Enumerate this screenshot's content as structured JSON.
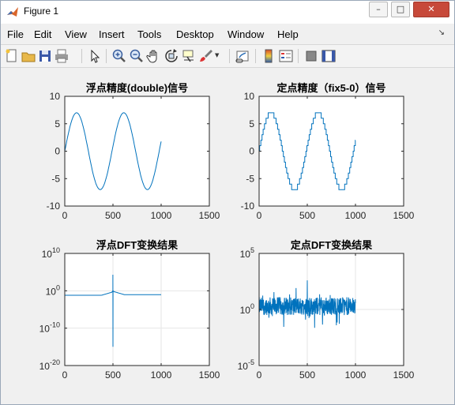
{
  "window": {
    "title": "Figure 1",
    "btn_minimize": "–",
    "btn_maximize": "□",
    "btn_close": "✕"
  },
  "menu": [
    "File",
    "Edit",
    "View",
    "Insert",
    "Tools",
    "Desktop",
    "Window",
    "Help"
  ],
  "toolbar_icons": [
    "new-figure-icon",
    "open-file-icon",
    "save-icon",
    "print-icon",
    "edit-plot-arrow-icon",
    "zoom-in-icon",
    "zoom-out-icon",
    "pan-hand-icon",
    "rotate-3d-icon",
    "data-cursor-icon",
    "brush-icon",
    "link-plot-icon",
    "colorbar-icon",
    "legend-icon",
    "hide-plot-tools-icon",
    "show-plot-tools-icon"
  ],
  "colors": {
    "line": "#0072bd",
    "grid": "#e6e6e6",
    "axes_bg": "#ffffff"
  },
  "chart_data": [
    {
      "type": "line",
      "title": "浮点精度(double)信号",
      "xlim": [
        0,
        1500
      ],
      "ylim": [
        -10,
        10
      ],
      "xticks": [
        "0",
        "500",
        "1000",
        "1500"
      ],
      "yticks": [
        "10",
        "5",
        "0",
        "-5",
        "-10"
      ],
      "series": [
        {
          "x_range": [
            0,
            1000
          ],
          "waveform": "sine",
          "amplitude": 7,
          "period": 490
        }
      ]
    },
    {
      "type": "line",
      "title": "定点精度（fix5-0）信号",
      "xlim": [
        0,
        1500
      ],
      "ylim": [
        -10,
        10
      ],
      "xticks": [
        "0",
        "500",
        "1000",
        "1500"
      ],
      "yticks": [
        "10",
        "5",
        "0",
        "-5",
        "-10"
      ],
      "series": [
        {
          "x_range": [
            0,
            1000
          ],
          "waveform": "quantized-sine",
          "amplitude": 7,
          "period": 490,
          "quantization_step": 1
        }
      ]
    },
    {
      "type": "line",
      "title": "浮点DFT变换结果",
      "xlim": [
        0,
        1500
      ],
      "ylim_log10": [
        -20,
        10
      ],
      "yscale": "log",
      "xticks": [
        "0",
        "500",
        "1000",
        "1500"
      ],
      "yticks": [
        {
          "base": "10",
          "exp": "10"
        },
        {
          "base": "10",
          "exp": "0"
        },
        {
          "base": "10",
          "exp": "-10"
        },
        {
          "base": "10",
          "exp": "-20"
        }
      ],
      "series": [
        {
          "x_range": [
            0,
            1000
          ],
          "shape": "flat-with-spike",
          "baseline_log10": -1.2,
          "spike_x": 500,
          "spike_high_log10": 4.3,
          "spike_low_log10": -15
        }
      ]
    },
    {
      "type": "line",
      "title": "定点DFT变换结果",
      "xlim": [
        0,
        1500
      ],
      "ylim_log10": [
        -5,
        5
      ],
      "yscale": "log",
      "xticks": [
        "0",
        "500",
        "1000",
        "1500"
      ],
      "yticks": [
        {
          "base": "10",
          "exp": "5"
        },
        {
          "base": "10",
          "exp": "0"
        },
        {
          "base": "10",
          "exp": "-5"
        }
      ],
      "series": [
        {
          "x_range": [
            0,
            1000
          ],
          "shape": "noisy-with-spike",
          "center_log10": 0.3,
          "spike_x": 500,
          "spike_high_log10": 2.6
        }
      ]
    }
  ]
}
